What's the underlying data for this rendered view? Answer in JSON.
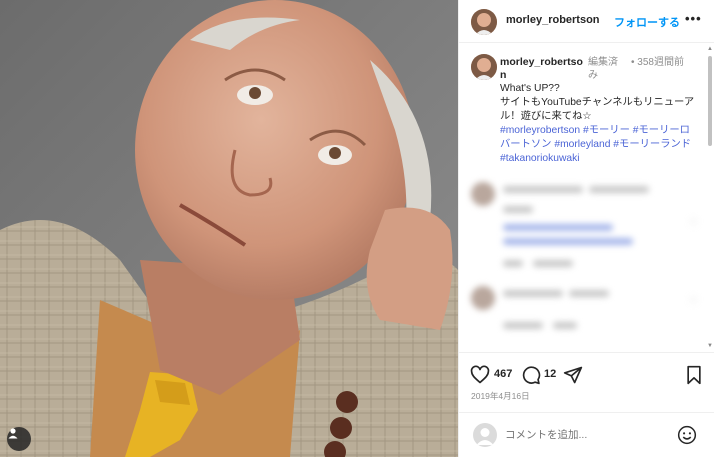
{
  "post": {
    "username": "morley_robertson",
    "follow_label": "フォローする",
    "more_label": "•••",
    "image_alt": "morley_robertson post photo"
  },
  "caption": {
    "username": "morley_robertson",
    "edited": "編集済み",
    "separator": "•",
    "time_ago": "358週間前",
    "line1": "What's UP??",
    "line2": "サイトもYouTubeチャンネルもリニューアル！遊びに来てね☆",
    "hashtags": "#morleyrobertson #モーリー #モーリーロバートソン #morleyland #モーリーランド #takanoriokuwaki"
  },
  "actions": {
    "like_count": "467",
    "comment_count": "12",
    "date": "2019年4月16日"
  },
  "comment_bar": {
    "placeholder": "コメントを追加..."
  },
  "icons": {
    "like": "heart-icon",
    "comment": "comment-bubble-icon",
    "share": "paper-plane-icon",
    "save": "bookmark-icon",
    "emoji": "smiley-icon",
    "user_tag": "person-icon"
  },
  "colors": {
    "accent": "#0095f6",
    "hashtag": "#4b64d6",
    "muted": "#8e8e8e",
    "text": "#262626"
  }
}
